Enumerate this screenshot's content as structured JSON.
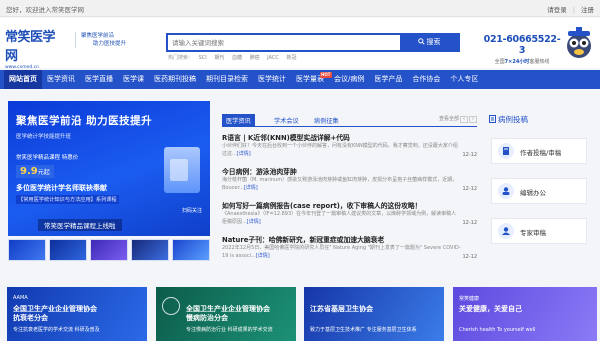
{
  "topbar": {
    "welcome": "您好，欢迎进入常笑医学网",
    "login": "请登录",
    "register": "注册"
  },
  "header": {
    "logo": "常笑医学网",
    "logo_url": "www.cxmed.cn",
    "slogan_1": "聚焦医学前沿",
    "slogan_2": "助力医技提升",
    "search_placeholder": "请输入关键词搜索",
    "search_button": "搜索",
    "hot_label": "热门搜索：",
    "hot_terms": [
      "SCI",
      "期刊",
      "血糖",
      "肺癌",
      "JACC",
      "新冠"
    ],
    "phone": "021-60665522-3",
    "phone_sub_pre": "全国",
    "phone_sub_hl": "7×24小时",
    "phone_sub_post": "客服热线"
  },
  "nav": {
    "items": [
      "网站首页",
      "医学资讯",
      "医学直播",
      "医学课",
      "医药期刊投稿",
      "期刊目录检索",
      "医学统计",
      "医学量表",
      "会议/病例",
      "医学产品",
      "合作协会",
      "个人专区"
    ],
    "hot_badge": "HOT",
    "accent": "#2452c8"
  },
  "banner": {
    "title": "聚焦医学前沿 助力医技提升",
    "sub": "医学统计学技能提升班",
    "cta": "常笑医学精品课程 特惠价",
    "price_num": "9.9",
    "price_unit": "元起",
    "line3": "多位医学统计学名师联袂奉献",
    "line4": "【常用医学统计知识与方法应用】系列课程",
    "scan": "扫码关注",
    "caption": "常笑医学精品课程上线啦"
  },
  "news": {
    "tabs": [
      "医学资讯",
      "学术会议",
      "病例征集"
    ],
    "more": "查看全部",
    "items": [
      {
        "title": "R语言 | K近邻(KNN)模型实战详解+代码",
        "desc": "小伙伴们好！今天在后台收到一个小伙伴的解答，问有没有KNN模型的代码。我才察觉到，还没跟大家介绍过这...",
        "detail": "[详情]",
        "date": "12-12"
      },
      {
        "title": "今日病例：游泳池肉芽肿",
        "desc": "海分枝杆菌（M. marinum）感染又称游泳池肉芽肿或鱼缸肉芽肿，皮损分布呈孢子丝菌病样模式，近期，Boucer...",
        "detail": "[详情]",
        "date": "12-12"
      },
      {
        "title": "如何写好一篇病例报告(case report)，收下审稿人的这份攻略！",
        "desc": "《Anaesthesia》（IF=12.893）在今年刊登了一篇审稿人建议类的文章，以麻醉学领域为例，解读审稿人拒稿原因...",
        "detail": "[详情]",
        "date": "12-12"
      },
      {
        "title": "Nature子刊：哈佛新研究，新冠重症或加速大脑衰老",
        "desc": "2022年12月5日，美国哈佛医学院的研究人员在\" Nature Aging \"期刊上发表了一篇题为\" Severe COVID-19 is associ...",
        "detail": "[详情]",
        "date": "12-12"
      }
    ]
  },
  "rcol": {
    "head": "病例投稿",
    "cards": [
      "作者投稿/审稿",
      "编辑办公",
      "专家审稿"
    ]
  },
  "bottom": [
    {
      "small": "AAMA",
      "title": "全国卫生产业企业管理协会\n抗衰老分会",
      "sub": "专注抗衰老医学的学术交流 科研及普及"
    },
    {
      "small": "",
      "title": "全国卫生产业企业管理协会\n慢病防治分会",
      "sub": "专注慢病防治行业 科研成果的学术交流"
    },
    {
      "small": "",
      "title": "江苏省基层卫生协会",
      "sub": "致力于基层卫生技术推广 专注服务基层卫生体系"
    },
    {
      "small": "常笑健康",
      "title": "关爱健康，关爱自己",
      "sub": "Cherish health  To yourself well"
    }
  ]
}
